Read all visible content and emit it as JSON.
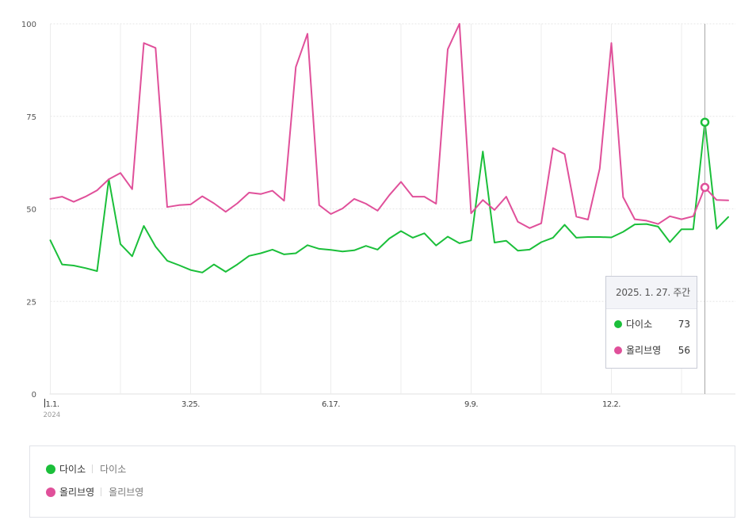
{
  "chart_data": {
    "type": "line",
    "ylim": [
      0,
      100
    ],
    "yticks": [
      0,
      25,
      50,
      75,
      100
    ],
    "x_tick_labels": [
      "1.1.",
      "3.25.",
      "6.17.",
      "9.9.",
      "12.2."
    ],
    "x_tick_sublabel": "2024",
    "series": [
      {
        "name": "다이소",
        "color": "#1bbf3a",
        "values": [
          41.5,
          35,
          34.7,
          34,
          33.2,
          58,
          40.5,
          37.2,
          45.4,
          39.8,
          36,
          34.8,
          33.5,
          32.8,
          35,
          33,
          35,
          37.3,
          38,
          39,
          37.7,
          38,
          40.2,
          39.2,
          38.9,
          38.5,
          38.8,
          40,
          39,
          42,
          44,
          42.2,
          43.4,
          40.1,
          42.5,
          40.7,
          41.5,
          65.5,
          40.9,
          41.4,
          38.7,
          39,
          41,
          42.2,
          45.7,
          42.2,
          42.4,
          42.4,
          42.3,
          43.8,
          45.8,
          45.9,
          45.2,
          41,
          44.5,
          44.5,
          73.4,
          44.6,
          47.8
        ]
      },
      {
        "name": "올리브영",
        "color": "#e0509a",
        "values": [
          52.7,
          53.3,
          51.9,
          53.3,
          55,
          58,
          59.7,
          55.3,
          94.8,
          93.5,
          50.5,
          51,
          51.2,
          53.4,
          51.5,
          49.2,
          51.5,
          54.4,
          54,
          54.9,
          52.2,
          88.3,
          97.3,
          51,
          48.6,
          50.1,
          52.7,
          51.4,
          49.5,
          53.7,
          57.3,
          53.3,
          53.3,
          51.4,
          93.1,
          100,
          48.8,
          52.4,
          49.7,
          53.3,
          46.5,
          44.8,
          46.1,
          66.4,
          64.8,
          47.9,
          47.1,
          60.9,
          94.8,
          53.2,
          47.2,
          46.8,
          45.9,
          48,
          47.2,
          48,
          55.8,
          52.4,
          52.3
        ]
      }
    ]
  },
  "tooltip": {
    "title": "2025. 1. 27. 주간",
    "index": 56,
    "rows": [
      {
        "name": "다이소",
        "value": "73"
      },
      {
        "name": "올리브영",
        "value": "56"
      }
    ]
  },
  "legend": {
    "items": [
      {
        "label": "다이소",
        "sublabel": "다이소"
      },
      {
        "label": "올리브영",
        "sublabel": "올리브영"
      }
    ]
  }
}
